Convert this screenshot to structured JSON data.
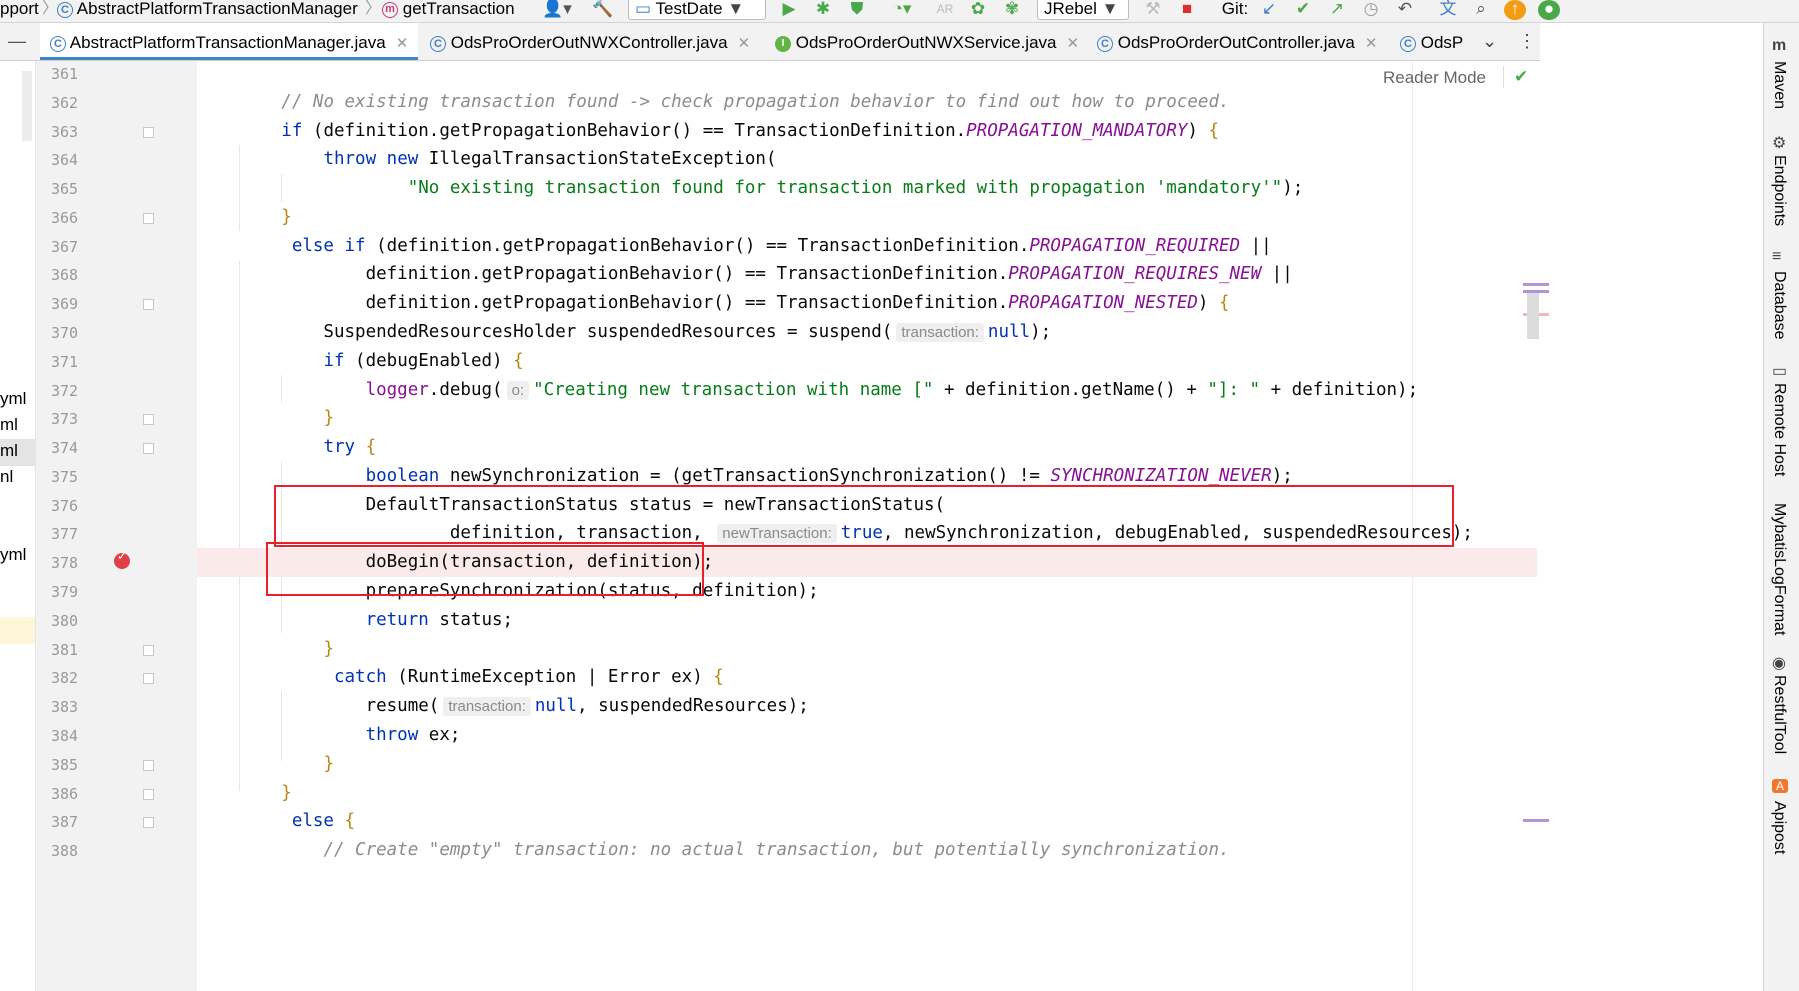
{
  "toolbar": {
    "crumbs": [
      "pport",
      "AbstractPlatformTransactionManager",
      "getTransaction"
    ],
    "run_config": "TestDate",
    "jrebel": "JRebel",
    "git_label": "Git:"
  },
  "tabs": [
    {
      "label": "AbstractPlatformTransactionManager.java",
      "badge": "c",
      "active": true
    },
    {
      "label": "OdsProOrderOutNWXController.java",
      "badge": "c"
    },
    {
      "label": "OdsProOrderOutNWXService.java",
      "badge": "I"
    },
    {
      "label": "OdsProOrderOutController.java",
      "badge": "c"
    },
    {
      "label": "OdsP",
      "badge": "c"
    }
  ],
  "left_strip_items": [
    "yml",
    "ml",
    "ml",
    "nl",
    "yml"
  ],
  "reader_mode": "Reader Mode",
  "right_tools": [
    "Maven",
    "Endpoints",
    "Database",
    "Remote Host",
    "MybatisLogFormat",
    "RestfulTool",
    "Apipost"
  ],
  "line_numbers": [
    "361",
    "362",
    "363",
    "364",
    "365",
    "366",
    "367",
    "368",
    "369",
    "370",
    "371",
    "372",
    "373",
    "374",
    "375",
    "376",
    "377",
    "378",
    "379",
    "380",
    "381",
    "382",
    "383",
    "384",
    "385",
    "386",
    "387",
    "388"
  ],
  "code_lines": [
    {
      "n": "361",
      "tokens": []
    },
    {
      "n": "362",
      "tokens": [
        {
          "t": "        "
        },
        {
          "t": "// No existing transaction found -> check propagation behavior to find out how to proceed.",
          "c": "cmt"
        }
      ]
    },
    {
      "n": "363",
      "tokens": [
        {
          "t": "        "
        },
        {
          "t": "if",
          "c": "kw"
        },
        {
          "t": " (definition.getPropagationBehavior() == TransactionDefinition."
        },
        {
          "t": "PROPAGATION_MANDATORY",
          "c": "cst"
        },
        {
          "t": ") "
        },
        {
          "t": "{",
          "c": "br"
        }
      ]
    },
    {
      "n": "364",
      "tokens": [
        {
          "t": "            "
        },
        {
          "t": "throw new",
          "c": "kw"
        },
        {
          "t": " IllegalTransactionStateException("
        }
      ]
    },
    {
      "n": "365",
      "tokens": [
        {
          "t": "                    "
        },
        {
          "t": "\"No existing transaction found for transaction marked with propagation 'mandatory'\"",
          "c": "str"
        },
        {
          "t": ");"
        }
      ]
    },
    {
      "n": "366",
      "tokens": [
        {
          "t": "        "
        },
        {
          "t": "}",
          "c": "br"
        }
      ]
    },
    {
      "n": "367",
      "tokens": [
        {
          "t": "         "
        },
        {
          "t": "else if",
          "c": "kw"
        },
        {
          "t": " (definition.getPropagationBehavior() == TransactionDefinition."
        },
        {
          "t": "PROPAGATION_REQUIRED",
          "c": "cst"
        },
        {
          "t": " ||"
        }
      ]
    },
    {
      "n": "368",
      "tokens": [
        {
          "t": "                definition.getPropagationBehavior() == TransactionDefinition."
        },
        {
          "t": "PROPAGATION_REQUIRES_NEW",
          "c": "cst"
        },
        {
          "t": " ||"
        }
      ]
    },
    {
      "n": "369",
      "tokens": [
        {
          "t": "                definition.getPropagationBehavior() == TransactionDefinition."
        },
        {
          "t": "PROPAGATION_NESTED",
          "c": "cst"
        },
        {
          "t": ") "
        },
        {
          "t": "{",
          "c": "br"
        }
      ]
    },
    {
      "n": "370",
      "tokens": [
        {
          "t": "            SuspendedResourcesHolder suspendedResources = suspend("
        },
        {
          "t": "transaction:",
          "c": "hint"
        },
        {
          "t": "null",
          "c": "kw"
        },
        {
          "t": ");"
        }
      ]
    },
    {
      "n": "371",
      "tokens": [
        {
          "t": "            "
        },
        {
          "t": "if",
          "c": "kw"
        },
        {
          "t": " (debugEnabled) "
        },
        {
          "t": "{",
          "c": "br"
        }
      ]
    },
    {
      "n": "372",
      "tokens": [
        {
          "t": "                "
        },
        {
          "t": "logger",
          "c": "fld"
        },
        {
          "t": ".debug("
        },
        {
          "t": "o:",
          "c": "hint"
        },
        {
          "t": "\"Creating new transaction with name [\"",
          "c": "str"
        },
        {
          "t": " + definition.getName() + "
        },
        {
          "t": "\"]: \"",
          "c": "str"
        },
        {
          "t": " + definition);"
        }
      ]
    },
    {
      "n": "373",
      "tokens": [
        {
          "t": "            "
        },
        {
          "t": "}",
          "c": "br"
        }
      ]
    },
    {
      "n": "374",
      "tokens": [
        {
          "t": "            "
        },
        {
          "t": "try",
          "c": "kw"
        },
        {
          "t": " "
        },
        {
          "t": "{",
          "c": "br"
        }
      ]
    },
    {
      "n": "375",
      "tokens": [
        {
          "t": "                "
        },
        {
          "t": "boolean",
          "c": "kw"
        },
        {
          "t": " newSynchronization = (getTransactionSynchronization() != "
        },
        {
          "t": "SYNCHRONIZATION_NEVER",
          "c": "cst"
        },
        {
          "t": ");"
        }
      ]
    },
    {
      "n": "376",
      "tokens": [
        {
          "t": "                DefaultTransactionStatus status = newTransactionStatus("
        }
      ]
    },
    {
      "n": "377",
      "tokens": [
        {
          "t": "                        definition, transaction, "
        },
        {
          "t": "newTransaction:",
          "c": "hint"
        },
        {
          "t": "true",
          "c": "kw"
        },
        {
          "t": ", newSynchronization, debugEnabled, suspendedResources);"
        }
      ]
    },
    {
      "n": "378",
      "tokens": [
        {
          "t": "                doBegin(transaction, definition);"
        }
      ],
      "highlight": true
    },
    {
      "n": "379",
      "tokens": [
        {
          "t": "                prepareSynchronization(status, definition);"
        }
      ]
    },
    {
      "n": "380",
      "tokens": [
        {
          "t": "                "
        },
        {
          "t": "return",
          "c": "kw"
        },
        {
          "t": " status;"
        }
      ]
    },
    {
      "n": "381",
      "tokens": [
        {
          "t": "            "
        },
        {
          "t": "}",
          "c": "br"
        }
      ]
    },
    {
      "n": "382",
      "tokens": [
        {
          "t": "             "
        },
        {
          "t": "catch",
          "c": "kw"
        },
        {
          "t": " (RuntimeException | Error ex) "
        },
        {
          "t": "{",
          "c": "br"
        }
      ]
    },
    {
      "n": "383",
      "tokens": [
        {
          "t": "                resume("
        },
        {
          "t": "transaction:",
          "c": "hint"
        },
        {
          "t": "null",
          "c": "kw"
        },
        {
          "t": ", suspendedResources);"
        }
      ]
    },
    {
      "n": "384",
      "tokens": [
        {
          "t": "                "
        },
        {
          "t": "throw",
          "c": "kw"
        },
        {
          "t": " ex;"
        }
      ]
    },
    {
      "n": "385",
      "tokens": [
        {
          "t": "            "
        },
        {
          "t": "}",
          "c": "br"
        }
      ]
    },
    {
      "n": "386",
      "tokens": [
        {
          "t": "        "
        },
        {
          "t": "}",
          "c": "br"
        }
      ]
    },
    {
      "n": "387",
      "tokens": [
        {
          "t": "         "
        },
        {
          "t": "else",
          "c": "kw"
        },
        {
          "t": " "
        },
        {
          "t": "{",
          "c": "br"
        }
      ]
    },
    {
      "n": "388",
      "tokens": [
        {
          "t": "            "
        },
        {
          "t": "// Create \"empty\" transaction: no actual transaction, but potentially synchronization.",
          "c": "cmt"
        }
      ]
    }
  ],
  "colors": {
    "accent": "#4083c9",
    "annotation_red": "#e8202a",
    "keyword": "#0033b3",
    "string": "#067d17",
    "constant": "#871094",
    "comment": "#8c8c8c",
    "breakpoint_line": "#fbeaea"
  }
}
